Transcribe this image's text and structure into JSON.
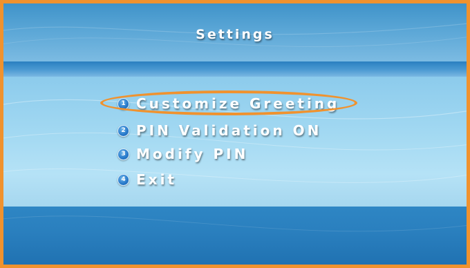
{
  "screen": {
    "title": "Settings",
    "accent_color": "#f0922e",
    "background_color": "#8ccbec"
  },
  "menu": {
    "items": [
      {
        "number": "1",
        "label": "Customize Greeting",
        "selected": true
      },
      {
        "number": "2",
        "label": "PIN Validation ON",
        "selected": false
      },
      {
        "number": "3",
        "label": "Modify PIN",
        "selected": false
      },
      {
        "number": "4",
        "label": "Exit",
        "selected": false
      }
    ]
  }
}
